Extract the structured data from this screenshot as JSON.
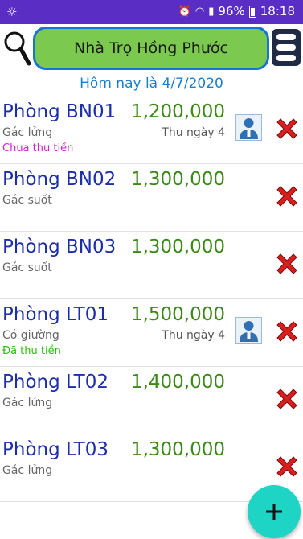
{
  "status_bar": {
    "battery": "96%",
    "time": "18:18"
  },
  "header": {
    "title": "Nhà Trọ Hồng Phước"
  },
  "today_label": "Hôm nay là 4/7/2020",
  "rooms": [
    {
      "name": "Phòng BN01",
      "price": "1,200,000",
      "desc": "Gác lửng",
      "due": "Thu ngày 4",
      "status": "Chưa thu tiền",
      "status_color": "#d61fd0"
    },
    {
      "name": "Phòng BN02",
      "price": "1,300,000",
      "desc": "Gác suốt"
    },
    {
      "name": "Phòng BN03",
      "price": "1,300,000",
      "desc": "Gác suốt"
    },
    {
      "name": "Phòng LT01",
      "price": "1,500,000",
      "desc": "Có giường",
      "due": "Thu ngày 4",
      "status": "Đã thu tiền",
      "status_color": "#2bbf12"
    },
    {
      "name": "Phòng LT02",
      "price": "1,400,000",
      "desc": "Gác lửng"
    },
    {
      "name": "Phòng LT03",
      "price": "1,300,000",
      "desc": "Gác lửng"
    }
  ],
  "icons": {
    "search": "search-icon",
    "menu": "menu-icon",
    "tenant": "tenant-icon",
    "delete": "delete-icon",
    "add": "add-icon"
  },
  "colors": {
    "status_bar": "#5a2ec4",
    "title_pill": "#7bc94f",
    "title_border": "#1873d6",
    "room_name": "#1c2fa8",
    "room_price": "#3b8a17",
    "today": "#1a7fd0",
    "fab": "#1ed4c5",
    "delete": "#d81e1e"
  }
}
